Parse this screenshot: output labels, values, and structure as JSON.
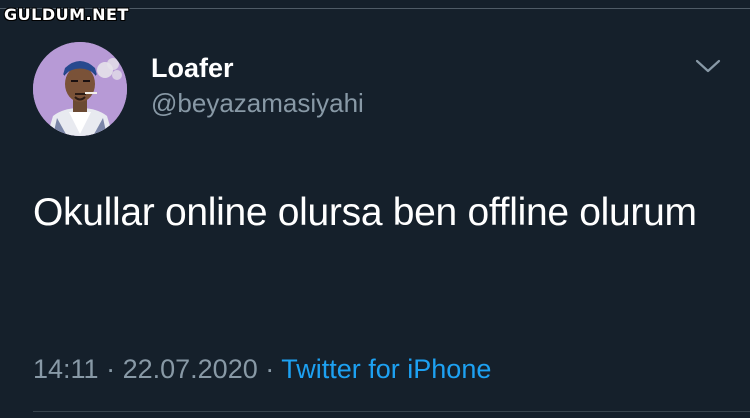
{
  "watermark": "GULDUM.NET",
  "tweet": {
    "author": {
      "display_name": "Loafer",
      "handle": "@beyazamasiyahi",
      "avatar_icon": "illustrated-rapper-avatar"
    },
    "text": "Okullar online olursa ben offline olurum",
    "time": "14:11",
    "separator_1": "·",
    "date": "22.07.2020",
    "separator_2": "·",
    "source": "Twitter for iPhone",
    "menu_icon": "chevron-down-icon"
  },
  "colors": {
    "background": "#15202b",
    "primary_text": "#ffffff",
    "secondary_text": "#8899a6",
    "link": "#1da1f2",
    "divider": "#38444d"
  }
}
